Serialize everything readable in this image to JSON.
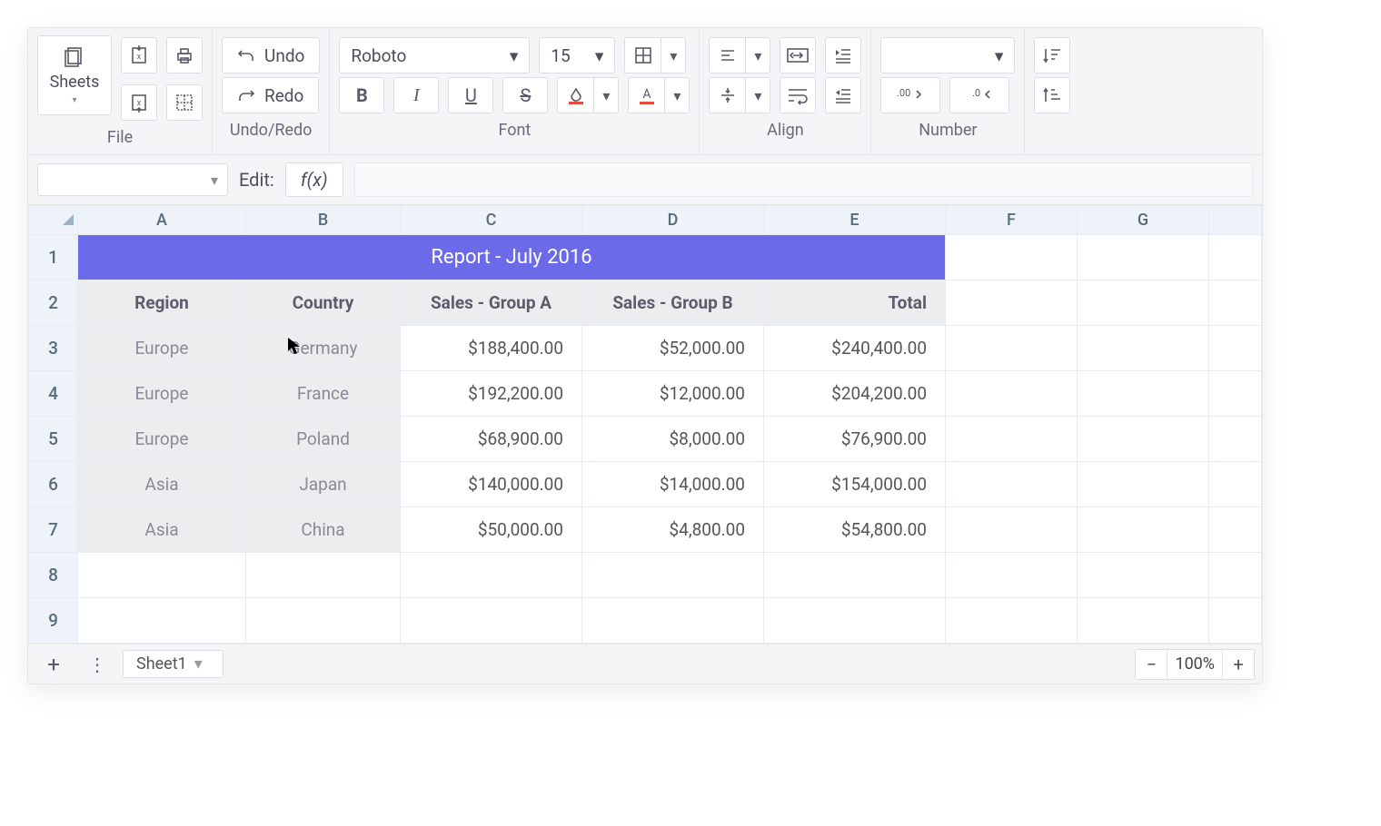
{
  "ribbon": {
    "sheets_label": "Sheets",
    "file_label": "File",
    "undo_label": "Undo",
    "redo_label": "Redo",
    "undoredo_label": "Undo/Redo",
    "font_name": "Roboto",
    "font_size": "15",
    "font_label": "Font",
    "align_label": "Align",
    "number_label": "Number",
    "bold": "B",
    "italic": "I",
    "underline": "U",
    "strike": "S"
  },
  "formula_bar": {
    "edit_label": "Edit:",
    "fx_label": "f(x)"
  },
  "columns": [
    "A",
    "B",
    "C",
    "D",
    "E",
    "F",
    "G"
  ],
  "rows_shown": [
    1,
    2,
    3,
    4,
    5,
    6,
    7,
    8,
    9
  ],
  "title_cell": "Report - July 2016",
  "headers": {
    "region": "Region",
    "country": "Country",
    "groupA": "Sales - Group A",
    "groupB": "Sales - Group B",
    "total": "Total"
  },
  "data": [
    {
      "region": "Europe",
      "country": "Germany",
      "a": "$188,400.00",
      "b": "$52,000.00",
      "t": "$240,400.00"
    },
    {
      "region": "Europe",
      "country": "France",
      "a": "$192,200.00",
      "b": "$12,000.00",
      "t": "$204,200.00"
    },
    {
      "region": "Europe",
      "country": "Poland",
      "a": "$68,900.00",
      "b": "$8,000.00",
      "t": "$76,900.00"
    },
    {
      "region": "Asia",
      "country": "Japan",
      "a": "$140,000.00",
      "b": "$14,000.00",
      "t": "$154,000.00"
    },
    {
      "region": "Asia",
      "country": "China",
      "a": "$50,000.00",
      "b": "$4,800.00",
      "t": "$54,800.00"
    }
  ],
  "bottom": {
    "sheet_tab": "Sheet1",
    "zoom": "100%"
  },
  "chart_data": {
    "type": "table",
    "title": "Report - July 2016",
    "columns": [
      "Region",
      "Country",
      "Sales - Group A",
      "Sales - Group B",
      "Total"
    ],
    "rows": [
      [
        "Europe",
        "Germany",
        188400,
        52000,
        240400
      ],
      [
        "Europe",
        "France",
        192200,
        12000,
        204200
      ],
      [
        "Europe",
        "Poland",
        68900,
        8000,
        76900
      ],
      [
        "Asia",
        "Japan",
        140000,
        14000,
        154000
      ],
      [
        "Asia",
        "China",
        50000,
        4800,
        54800
      ]
    ]
  }
}
